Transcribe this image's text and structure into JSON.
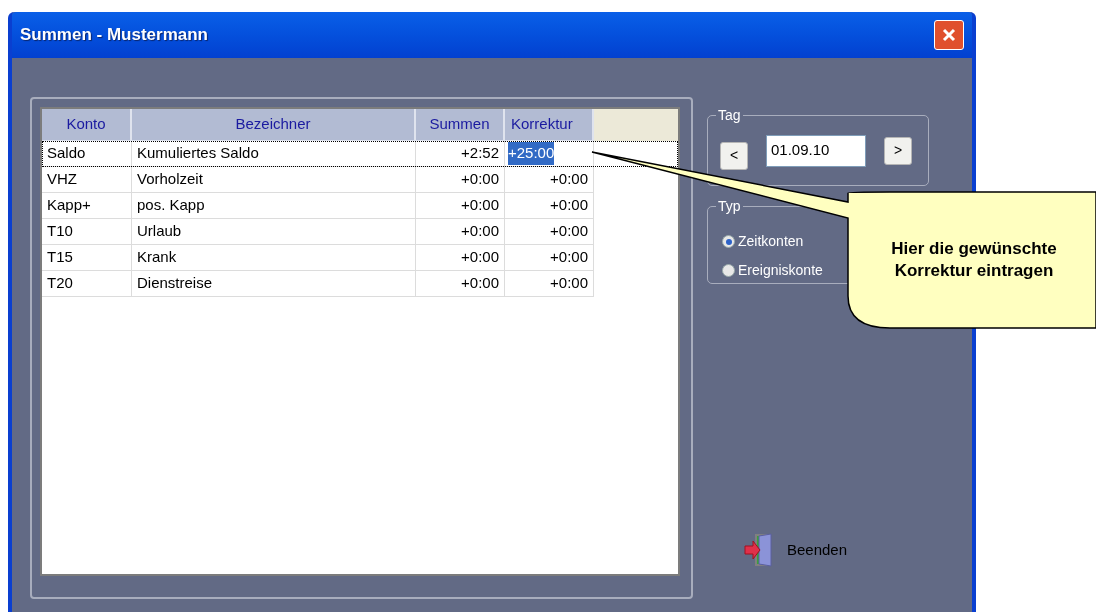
{
  "window": {
    "title": "Summen - Mustermann"
  },
  "table": {
    "columns": [
      "Konto",
      "Bezeichner",
      "Summen",
      "Korrektur"
    ],
    "rows": [
      {
        "cells": [
          "Saldo",
          "Kumuliertes Saldo",
          "+2:52",
          "+25:00"
        ],
        "selected": true
      },
      {
        "cells": [
          "VHZ",
          "Vorholzeit",
          "+0:00",
          "+0:00"
        ],
        "selected": false
      },
      {
        "cells": [
          "Kapp+",
          "pos. Kapp",
          "+0:00",
          "+0:00"
        ],
        "selected": false
      },
      {
        "cells": [
          "T10",
          "Urlaub",
          "+0:00",
          "+0:00"
        ],
        "selected": false
      },
      {
        "cells": [
          "T15",
          "Krank",
          "+0:00",
          "+0:00"
        ],
        "selected": false
      },
      {
        "cells": [
          "T20",
          "Dienstreise",
          "+0:00",
          "+0:00"
        ],
        "selected": false
      }
    ]
  },
  "tag": {
    "label": "Tag",
    "prev": "<",
    "date": "01.09.10",
    "next": ">"
  },
  "typ": {
    "label": "Typ",
    "options": [
      {
        "label": "Zeitkonten",
        "selected": true
      },
      {
        "label": "Ereigniskonte",
        "selected": false
      }
    ]
  },
  "exit_button": "Beenden",
  "callout": "Hier die gewünschte Korrektur eintragen"
}
